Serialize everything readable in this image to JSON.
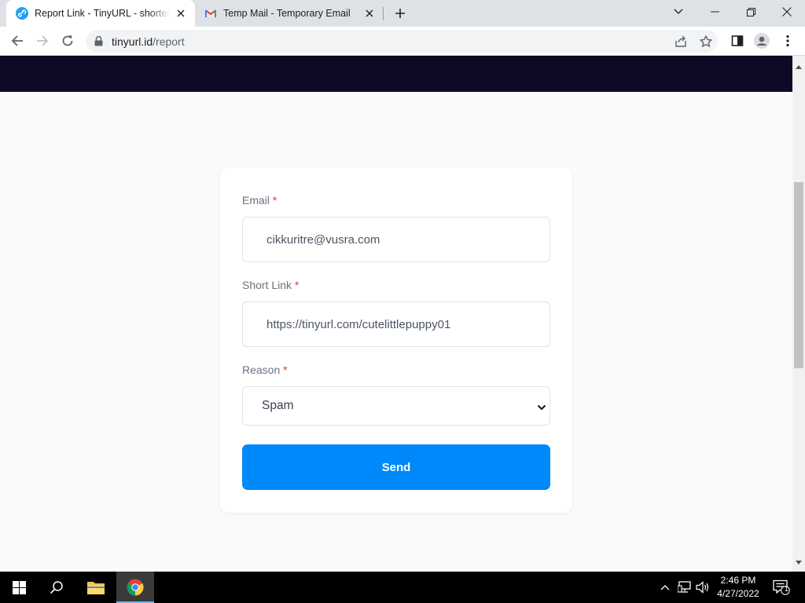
{
  "browser": {
    "tabs": [
      {
        "title": "Report Link - TinyURL - shorten t",
        "active": true
      },
      {
        "title": "Temp Mail - Temporary Email",
        "active": false
      }
    ],
    "address": {
      "domain": "tinyurl.id",
      "path": "/report"
    }
  },
  "form": {
    "email": {
      "label": "Email",
      "required_mark": "*",
      "value": "cikkuritre@vusra.com"
    },
    "short_link": {
      "label": "Short Link",
      "required_mark": "*",
      "value": "https://tinyurl.com/cutelittlepuppy01"
    },
    "reason": {
      "label": "Reason",
      "required_mark": "*",
      "selected": "Spam"
    },
    "submit_label": "Send"
  },
  "taskbar": {
    "time": "2:46 PM",
    "date": "4/27/2022",
    "notification_count": "1"
  },
  "colors": {
    "header_bg": "#0c0a24",
    "button_bg": "#0089fb",
    "page_bg": "#f9fafb",
    "required": "#e3342f"
  }
}
